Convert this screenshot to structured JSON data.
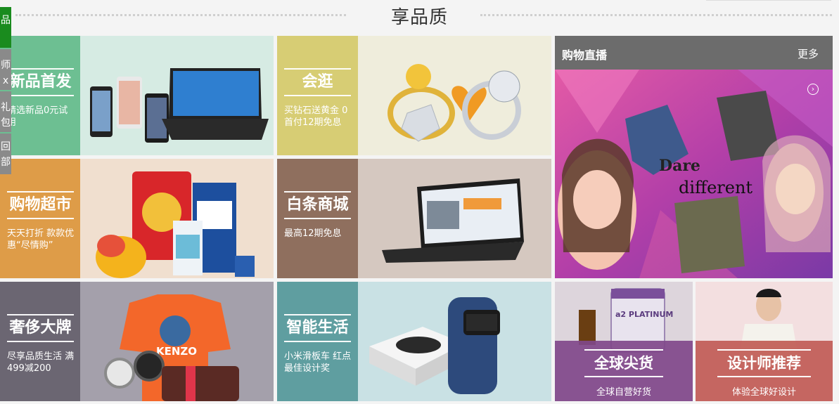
{
  "header": {
    "title": "享品质"
  },
  "sidenav": [
    "品",
    "师 x",
    "礼 包",
    "回 部"
  ],
  "tiles": [
    {
      "title": "新品首发",
      "sub": "精选新品0元试用",
      "color": "#6dbf92"
    },
    {
      "title": "会逛",
      "sub": "买钻石送黄金 0首付12期免息",
      "color": "#d7cd74"
    },
    {
      "title": "购物超市",
      "sub": "天天打折 款款优惠“尽情购”",
      "color": "#de9c48"
    },
    {
      "title": "白条商城",
      "sub": "最高12期免息",
      "color": "#8f6f5e"
    },
    {
      "title": "奢侈大牌",
      "sub": "尽享品质生活 满499减200",
      "color": "#6b6672"
    },
    {
      "title": "智能生活",
      "sub": "小米滑板车 红点最佳设计奖",
      "color": "#5f9ea0"
    }
  ],
  "live": {
    "title": "购物直播",
    "more": "更多"
  },
  "small_tiles": [
    {
      "title": "全球尖货",
      "sub": "全球自营好货"
    },
    {
      "title": "设计师推荐",
      "sub": "体验全球好设计"
    }
  ],
  "image_text": {
    "dare": "Dare",
    "different": "different",
    "kenzo": "KENZO",
    "platinum": "a2 PLATINUM"
  }
}
